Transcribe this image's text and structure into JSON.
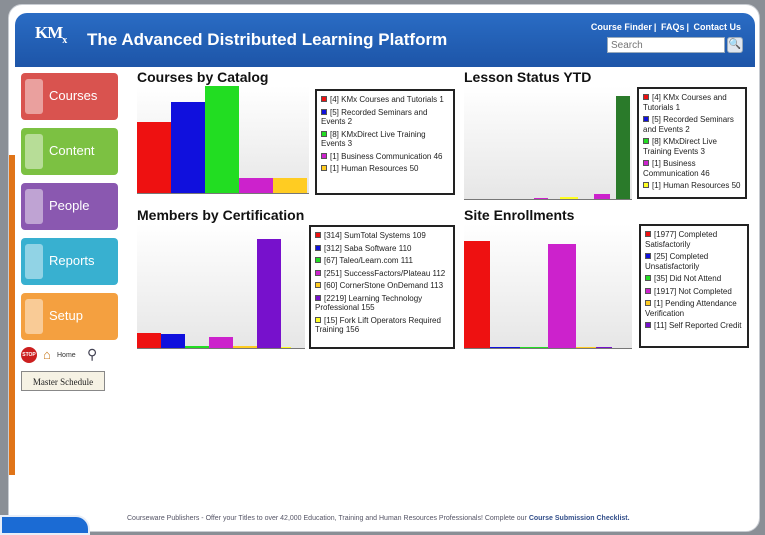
{
  "header": {
    "logo": "KM",
    "logo_sub": "x",
    "title": "The Advanced Distributed Learning Platform",
    "links": [
      "Course Finder",
      "FAQs",
      "Contact Us"
    ],
    "search_placeholder": "Search"
  },
  "nav": {
    "courses": "Courses",
    "content": "Content",
    "people": "People",
    "reports": "Reports",
    "setup": "Setup",
    "stop": "STOP",
    "home": "Home",
    "master_schedule": "Master Schedule"
  },
  "colors": {
    "red": "#ee1111",
    "blue": "#1010dd",
    "green": "#22dd22",
    "magenta": "#cc22cc",
    "yellow": "#ffcc22",
    "darkgreen": "#2a7a2a",
    "purple": "#7711cc",
    "brightyellow": "#ffff22"
  },
  "chart_data": [
    {
      "type": "bar",
      "title": "Courses by Catalog",
      "ylim": [
        0,
        50
      ],
      "series": [
        {
          "name": "[4] KMx Courses and Tutorials 1",
          "value": 1,
          "color": "#ee1111"
        },
        {
          "name": "[5] Recorded Seminars and Events 2",
          "value": 2,
          "color": "#1010dd"
        },
        {
          "name": "[8] KMxDirect Live Training Events 3",
          "value": 3,
          "color": "#22dd22"
        },
        {
          "name": "[1] Business Communication 46",
          "value": 46,
          "color": "#cc22cc"
        },
        {
          "name": "[1] Human Resources 50",
          "value": 50,
          "color": "#ffcc22"
        }
      ],
      "bar_values": [
        22,
        28,
        33,
        5,
        5
      ]
    },
    {
      "type": "bar",
      "title": "Lesson Status YTD",
      "series": [
        {
          "name": "[4] KMx Courses and Tutorials 1",
          "value": 1,
          "color": "#ee1111"
        },
        {
          "name": "[5] Recorded Seminars and Events 2",
          "value": 2,
          "color": "#1010dd"
        },
        {
          "name": "[8] KMxDirect Live Training Events 3",
          "value": 3,
          "color": "#22dd22"
        },
        {
          "name": "[1] Business Communication 46",
          "value": 46,
          "color": "#cc22cc"
        },
        {
          "name": "[1] Human Resources 50",
          "value": 50,
          "color": "#ffff22"
        }
      ],
      "bar_values": [
        0,
        0,
        0,
        1,
        3,
        0,
        6,
        0,
        110
      ],
      "bar_colors": [
        "#ee1111",
        "#1010dd",
        "#22dd22",
        "#cc22cc",
        "#ffff22",
        "#1010dd",
        "#cc22cc",
        "#22dd22",
        "#2a7a2a"
      ]
    },
    {
      "type": "bar",
      "title": "Members by Certification",
      "series": [
        {
          "name": "[314] SumTotal Systems 109",
          "value": 109,
          "color": "#ee1111"
        },
        {
          "name": "[312] Saba Software 110",
          "value": 110,
          "color": "#1010dd"
        },
        {
          "name": "[67] Taleo/Learn.com 111",
          "value": 111,
          "color": "#22dd22"
        },
        {
          "name": "[251] SuccessFactors/Plateau 112",
          "value": 112,
          "color": "#cc22cc"
        },
        {
          "name": "[60] CornerStone OnDemand 113",
          "value": 113,
          "color": "#ffcc22"
        },
        {
          "name": "[2219] Learning Technology Professional 155",
          "value": 155,
          "color": "#7711cc"
        },
        {
          "name": "[15] Fork Lift Operators Required Training 156",
          "value": 156,
          "color": "#ffff22"
        }
      ],
      "bar_values": [
        314,
        312,
        67,
        251,
        60,
        2219,
        15
      ]
    },
    {
      "type": "bar",
      "title": "Site Enrollments",
      "series": [
        {
          "name": "[1977] Completed Satisfactorily",
          "value": 1977,
          "color": "#ee1111"
        },
        {
          "name": "[25] Completed Unsatisfactorily",
          "value": 25,
          "color": "#1010dd"
        },
        {
          "name": "[35] Did Not Attend",
          "value": 35,
          "color": "#22dd22"
        },
        {
          "name": "[1917] Not Completed",
          "value": 1917,
          "color": "#cc22cc"
        },
        {
          "name": "[1] Pending Attendance Verification",
          "value": 1,
          "color": "#ffcc22"
        },
        {
          "name": "[11] Self Reported Credit",
          "value": 11,
          "color": "#7711cc"
        }
      ],
      "bar_values": [
        1977,
        25,
        35,
        1917,
        1,
        11
      ]
    }
  ],
  "footer": {
    "text": "Courseware Publishers - Offer your Titles to over 42,000 Education, Training and Human Resources Professionals! Complete our",
    "link": "Course Submission Checklist."
  }
}
